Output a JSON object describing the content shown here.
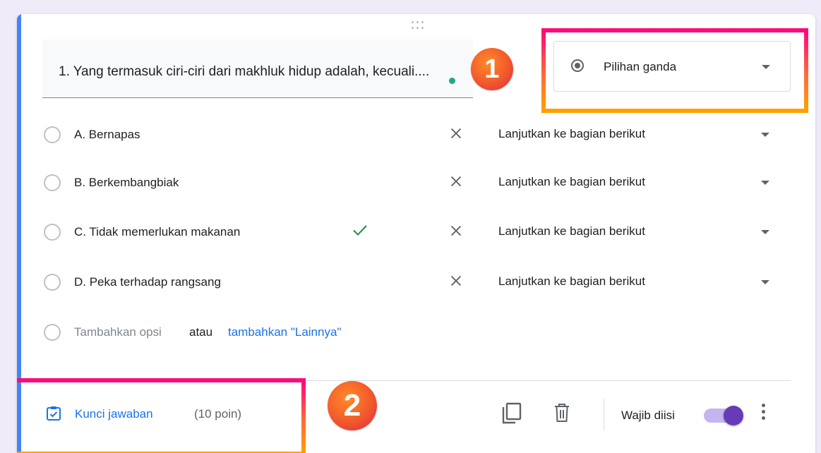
{
  "question": {
    "text": "1. Yang termasuk ciri-ciri dari makhluk hidup adalah, kecuali...."
  },
  "question_type": {
    "selected": "Pilihan ganda"
  },
  "badges": {
    "one": "1",
    "two": "2"
  },
  "options": [
    {
      "label": "A. Bernapas",
      "correct": false,
      "goto": "Lanjutkan ke bagian berikut"
    },
    {
      "label": "B. Berkembangbiak",
      "correct": false,
      "goto": "Lanjutkan ke bagian berikut"
    },
    {
      "label": "C. Tidak memerlukan makanan",
      "correct": true,
      "goto": "Lanjutkan ke bagian berikut"
    },
    {
      "label": "D. Peka terhadap rangsang",
      "correct": false,
      "goto": "Lanjutkan ke bagian berikut"
    }
  ],
  "add_option": {
    "add_label": "Tambahkan opsi",
    "or_label": "atau",
    "other_link": "tambahkan \"Lainnya\""
  },
  "footer": {
    "answer_key_label": "Kunci jawaban",
    "points_label": "(10 poin)",
    "required_label": "Wajib diisi",
    "required_on": true
  },
  "colors": {
    "accent": "#4285f4",
    "link": "#1a73e8",
    "toggle": "#673ab7",
    "check": "#1e8e3e"
  }
}
